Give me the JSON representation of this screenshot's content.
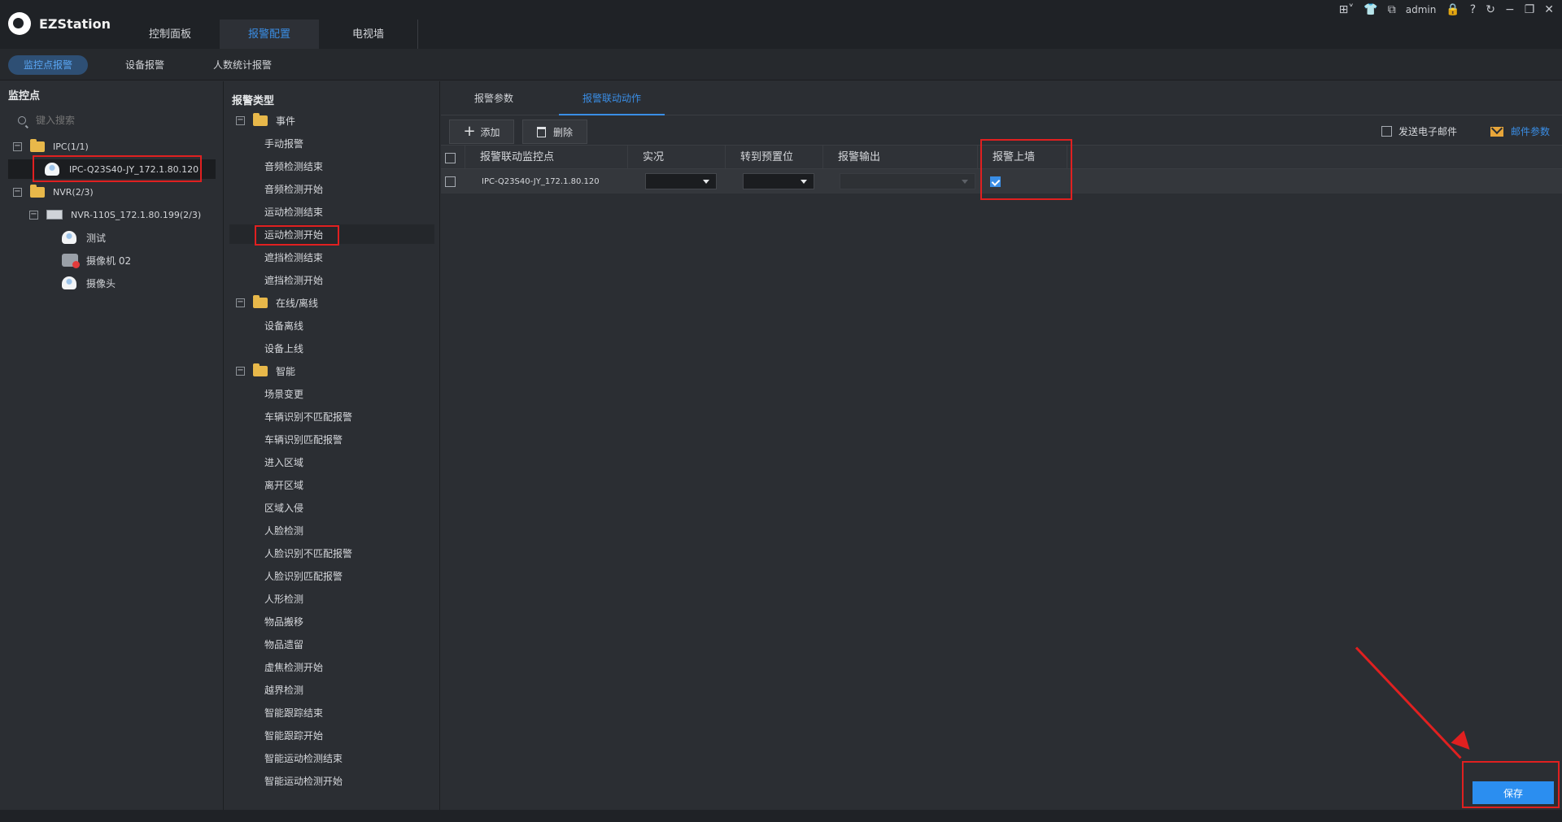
{
  "app": {
    "title": "EZStation"
  },
  "main_tabs": [
    {
      "label": "控制面板"
    },
    {
      "label": "报警配置"
    },
    {
      "label": "电视墙"
    }
  ],
  "top_icons": {
    "admin_label": "admin"
  },
  "sub_tabs": [
    {
      "label": "监控点报警"
    },
    {
      "label": "设备报警"
    },
    {
      "label": "人数统计报警"
    }
  ],
  "left_panel": {
    "title": "监控点",
    "search_placeholder": "键入搜索",
    "tree": [
      {
        "label": "IPC(1/1)"
      },
      {
        "label": "IPC-Q23S40-JY_172.1.80.120"
      },
      {
        "label": "NVR(2/3)"
      },
      {
        "label": "NVR-110S_172.1.80.199(2/3)"
      },
      {
        "label": "测试"
      },
      {
        "label": "摄像机 02"
      },
      {
        "label": "摄像头"
      }
    ]
  },
  "alarm_types": {
    "title": "报警类型",
    "groups": [
      {
        "label": "事件"
      },
      {
        "label": "在线/离线"
      },
      {
        "label": "智能"
      }
    ],
    "items": [
      "手动报警",
      "音频检测结束",
      "音频检测开始",
      "运动检测结束",
      "运动检测开始",
      "遮挡检测结束",
      "遮挡检测开始",
      "设备离线",
      "设备上线",
      "场景变更",
      "车辆识别不匹配报警",
      "车辆识别匹配报警",
      "进入区域",
      "离开区域",
      "区域入侵",
      "人脸检测",
      "人脸识别不匹配报警",
      "人脸识别匹配报警",
      "人形检测",
      "物品搬移",
      "物品遗留",
      "虚焦检测开始",
      "越界检测",
      "智能跟踪结束",
      "智能跟踪开始",
      "智能运动检测结束",
      "智能运动检测开始"
    ]
  },
  "right_panel": {
    "tabs": [
      {
        "label": "报警参数"
      },
      {
        "label": "报警联动动作"
      }
    ],
    "toolbar": {
      "add_label": "添加",
      "delete_label": "删除",
      "send_email_label": "发送电子邮件",
      "mail_params_label": "邮件参数"
    },
    "table": {
      "headers": [
        "报警联动监控点",
        "实况",
        "转到预置位",
        "报警输出",
        "报警上墙"
      ],
      "rows": [
        {
          "camera": "IPC-Q23S40-JY_172.1.80.120",
          "live": "",
          "preset": "",
          "output": "",
          "wall_checked": true
        }
      ]
    },
    "save_label": "保存"
  },
  "colors": {
    "accent": "#3a8ee6",
    "highlight": "#e02020",
    "background": "#2b2e33"
  }
}
